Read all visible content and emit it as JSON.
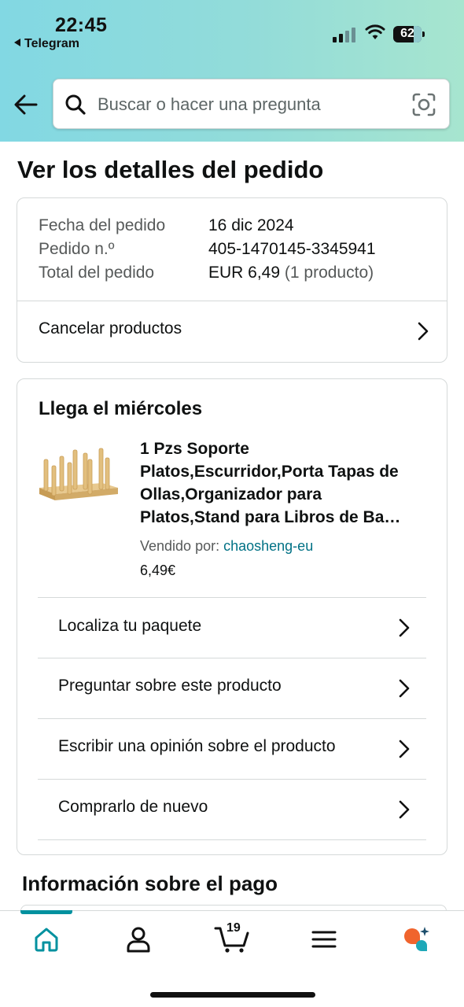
{
  "status_bar": {
    "time": "22:45",
    "back_app": "Telegram",
    "battery": "62"
  },
  "search": {
    "placeholder": "Buscar o hacer una pregunta"
  },
  "page_title": "Ver los detalles del pedido",
  "order_summary": {
    "date_label": "Fecha del pedido",
    "date_value": "16 dic 2024",
    "number_label": "Pedido n.º",
    "number_value": "405-1470145-3345941",
    "total_label": "Total del pedido",
    "total_value": "EUR 6,49",
    "total_count": "(1 producto)",
    "cancel_label": "Cancelar productos"
  },
  "shipment": {
    "heading": "Llega el miércoles",
    "product_title": "1 Pzs Soporte Platos,Escurridor,Porta Tapas de Ollas,Organizador para Platos,Stand para Libros de Ba…",
    "seller_label": "Vendido por:",
    "seller_name": "chaosheng-eu",
    "price": "6,49€",
    "actions": [
      {
        "label": "Localiza tu paquete"
      },
      {
        "label": "Preguntar sobre este producto"
      },
      {
        "label": "Escribir una opinión sobre el producto"
      },
      {
        "label": "Comprarlo de nuevo"
      }
    ]
  },
  "payment_heading": "Información sobre el pago",
  "bottom_nav": {
    "cart_count": "19",
    "items": [
      "home-icon",
      "account-icon",
      "cart-icon",
      "menu-icon",
      "rufus-icon"
    ],
    "accent_color": "#00919f"
  }
}
